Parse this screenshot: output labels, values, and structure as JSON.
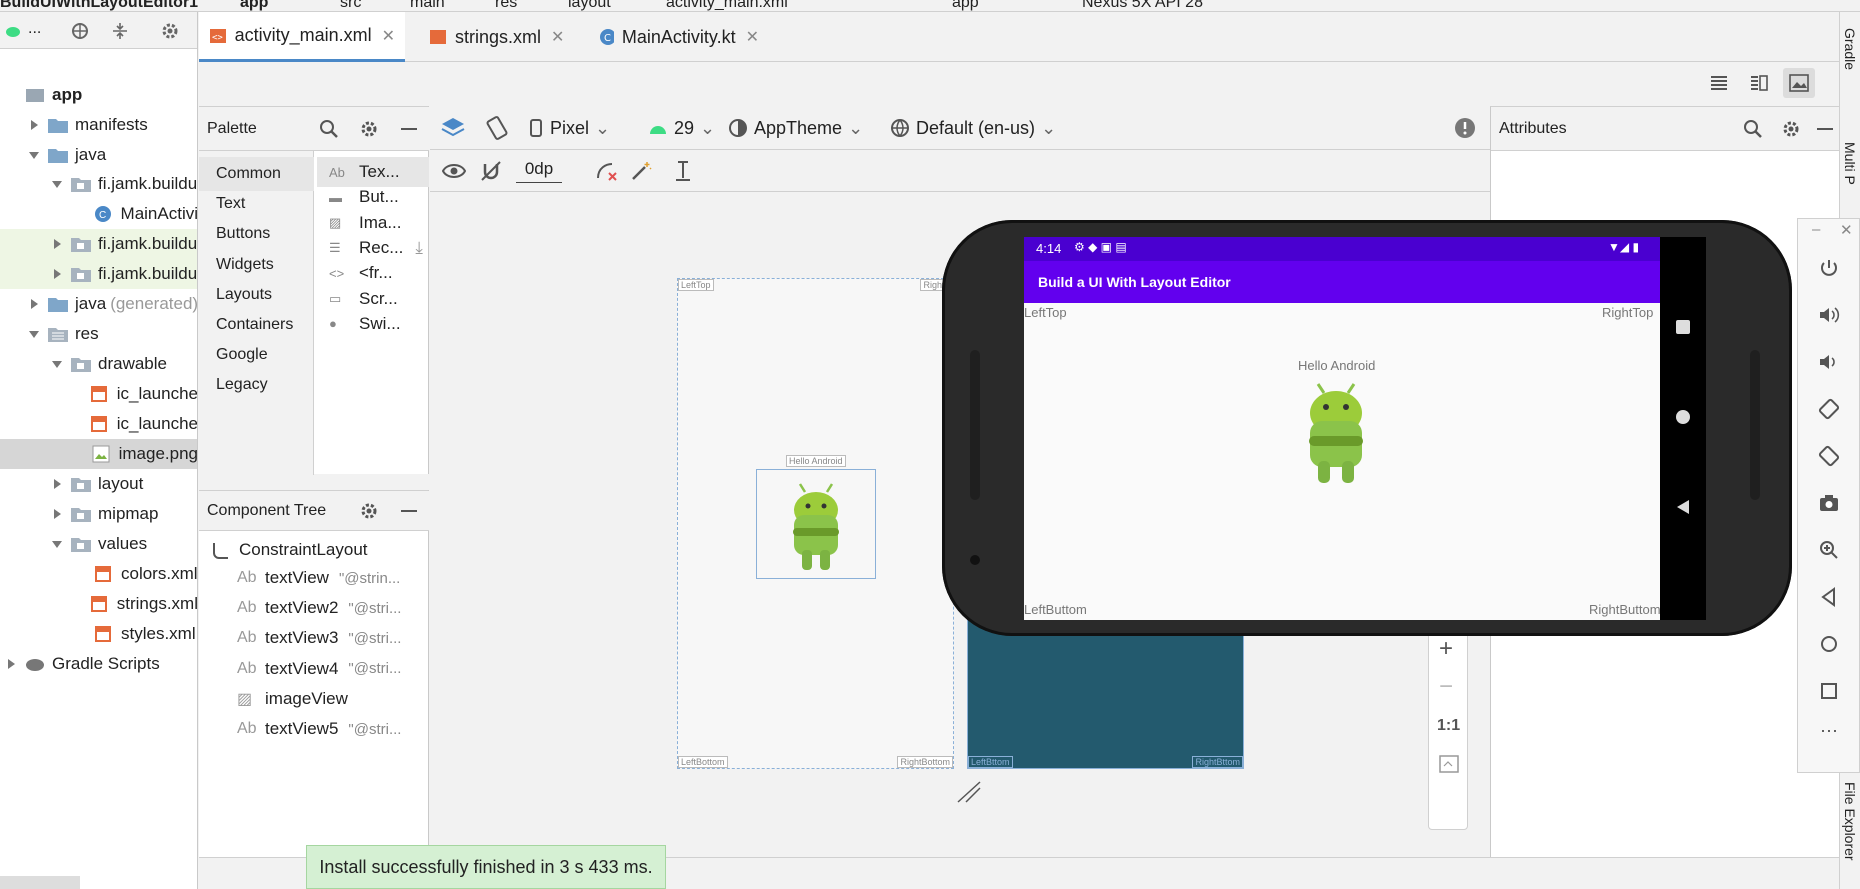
{
  "navbar": {
    "project": "BuildUIWithLayoutEditor1",
    "crumbs": [
      "app",
      "src",
      "main",
      "res",
      "layout",
      "activity_main.xml"
    ],
    "run_config": "app",
    "device": "Nexus 5X API 28"
  },
  "project_panel": {
    "header_label": "...",
    "items": [
      {
        "label": "app",
        "bold": true
      },
      {
        "label": "manifests"
      },
      {
        "label": "java"
      },
      {
        "label": "fi.jamk.buildu"
      },
      {
        "label": "MainActivi"
      },
      {
        "label": "fi.jamk.buildu"
      },
      {
        "label": "fi.jamk.buildu"
      },
      {
        "label": "java",
        "suffix": "(generated)"
      },
      {
        "label": "res"
      },
      {
        "label": "drawable"
      },
      {
        "label": "ic_launche"
      },
      {
        "label": "ic_launche"
      },
      {
        "label": "image.png"
      },
      {
        "label": "layout"
      },
      {
        "label": "mipmap"
      },
      {
        "label": "values"
      },
      {
        "label": "colors.xml"
      },
      {
        "label": "strings.xml"
      },
      {
        "label": "styles.xml"
      },
      {
        "label": "Gradle Scripts"
      }
    ]
  },
  "tabs": [
    {
      "label": "activity_main.xml",
      "active": true
    },
    {
      "label": "strings.xml"
    },
    {
      "label": "MainActivity.kt"
    }
  ],
  "palette": {
    "title": "Palette",
    "categories": [
      "Common",
      "Text",
      "Buttons",
      "Widgets",
      "Layouts",
      "Containers",
      "Google",
      "Legacy"
    ],
    "items": [
      "Tex...",
      "But...",
      "Ima...",
      "Rec...",
      "<fr...",
      "Scr...",
      "Swi..."
    ]
  },
  "design_toolbar": {
    "device": "Pixel",
    "api": "29",
    "theme": "AppTheme",
    "locale": "Default (en-us)",
    "margin": "0dp"
  },
  "component_tree": {
    "title": "Component Tree",
    "root": "ConstraintLayout",
    "children": [
      {
        "name": "textView",
        "attr": "\"@strin..."
      },
      {
        "name": "textView2",
        "attr": "\"@stri..."
      },
      {
        "name": "textView3",
        "attr": "\"@stri..."
      },
      {
        "name": "textView4",
        "attr": "\"@stri..."
      },
      {
        "name": "imageView",
        "attr": ""
      },
      {
        "name": "textView5",
        "attr": "\"@stri..."
      }
    ]
  },
  "blueprint": {
    "left_top": "LeftTop",
    "right_top": "RightT",
    "hello": "Hello Android",
    "left_bottom": "LeftBottom",
    "right_bottom": "RightBottom",
    "left_bottom_r": "LeftBttom",
    "right_bottom_r": "RightBttom"
  },
  "attributes": {
    "title": "Attributes"
  },
  "zoom": {
    "ratio": "1:1"
  },
  "toast": "Install successfully finished in 3 s 433 ms.",
  "emulator": {
    "time": "4:14",
    "app_title": "Build a UI With Layout Editor",
    "left_top": "LeftTop",
    "right_top": "RightTop",
    "hello": "Hello Android",
    "left_bottom": "LeftButtom",
    "right_bottom": "RightButtom"
  },
  "right_stripe": [
    "Gradle",
    "Multi P",
    "File Explorer"
  ],
  "colors": {
    "accent": "#6200ee",
    "status": "#4a00d0",
    "blueprint": "#235a6e",
    "toast": "#d5f0d3"
  }
}
